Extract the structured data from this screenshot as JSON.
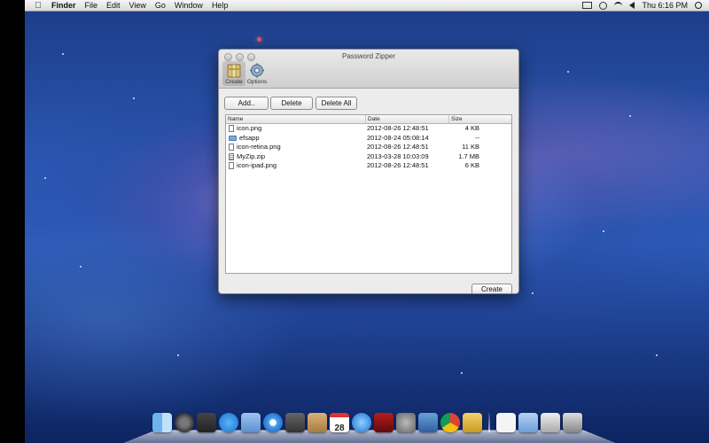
{
  "menubar": {
    "apple_icon": "apple-icon",
    "items": [
      "Finder",
      "File",
      "Edit",
      "View",
      "Go",
      "Window",
      "Help"
    ],
    "clock": "Thu 6:16 PM",
    "status_icons": [
      "screen-mirroring-icon",
      "time-machine-icon",
      "wifi-icon",
      "volume-icon",
      "spotlight-search-icon"
    ]
  },
  "window": {
    "title": "Password Zipper",
    "toolbar": {
      "create_label": "Create",
      "options_label": "Options"
    },
    "buttons": {
      "add": "Add..",
      "delete": "Delete",
      "delete_all": "Delete All",
      "create": "Create"
    },
    "file_list": {
      "columns": {
        "name": "Name",
        "date": "Date",
        "size": "Size"
      },
      "rows": [
        {
          "icon": "file-icon",
          "name": "icon.png",
          "date": "2012-08-26 12:48:51",
          "size": "4 KB"
        },
        {
          "icon": "folder-icon",
          "name": "efsapp",
          "date": "2012-08-24 05:08:14",
          "size": "--"
        },
        {
          "icon": "file-icon",
          "name": "icon-retina.png",
          "date": "2012-08-26 12:48:51",
          "size": "11 KB"
        },
        {
          "icon": "zip-icon",
          "name": "MyZip.zip",
          "date": "2013-03-28 10:03:09",
          "size": "1.7 MB"
        },
        {
          "icon": "file-icon",
          "name": "icon-ipad.png",
          "date": "2012-08-26 12:48:51",
          "size": "6 KB"
        }
      ]
    }
  },
  "dock": {
    "calendar_day": "28",
    "items": [
      "finder",
      "launchpad",
      "mission-control",
      "app-store",
      "preview",
      "safari",
      "facetime",
      "contacts",
      "calendar",
      "itunes",
      "photo-booth",
      "system-preferences",
      "xcode",
      "chrome",
      "archive-utility",
      "document",
      "downloads-folder",
      "display",
      "trash"
    ]
  }
}
